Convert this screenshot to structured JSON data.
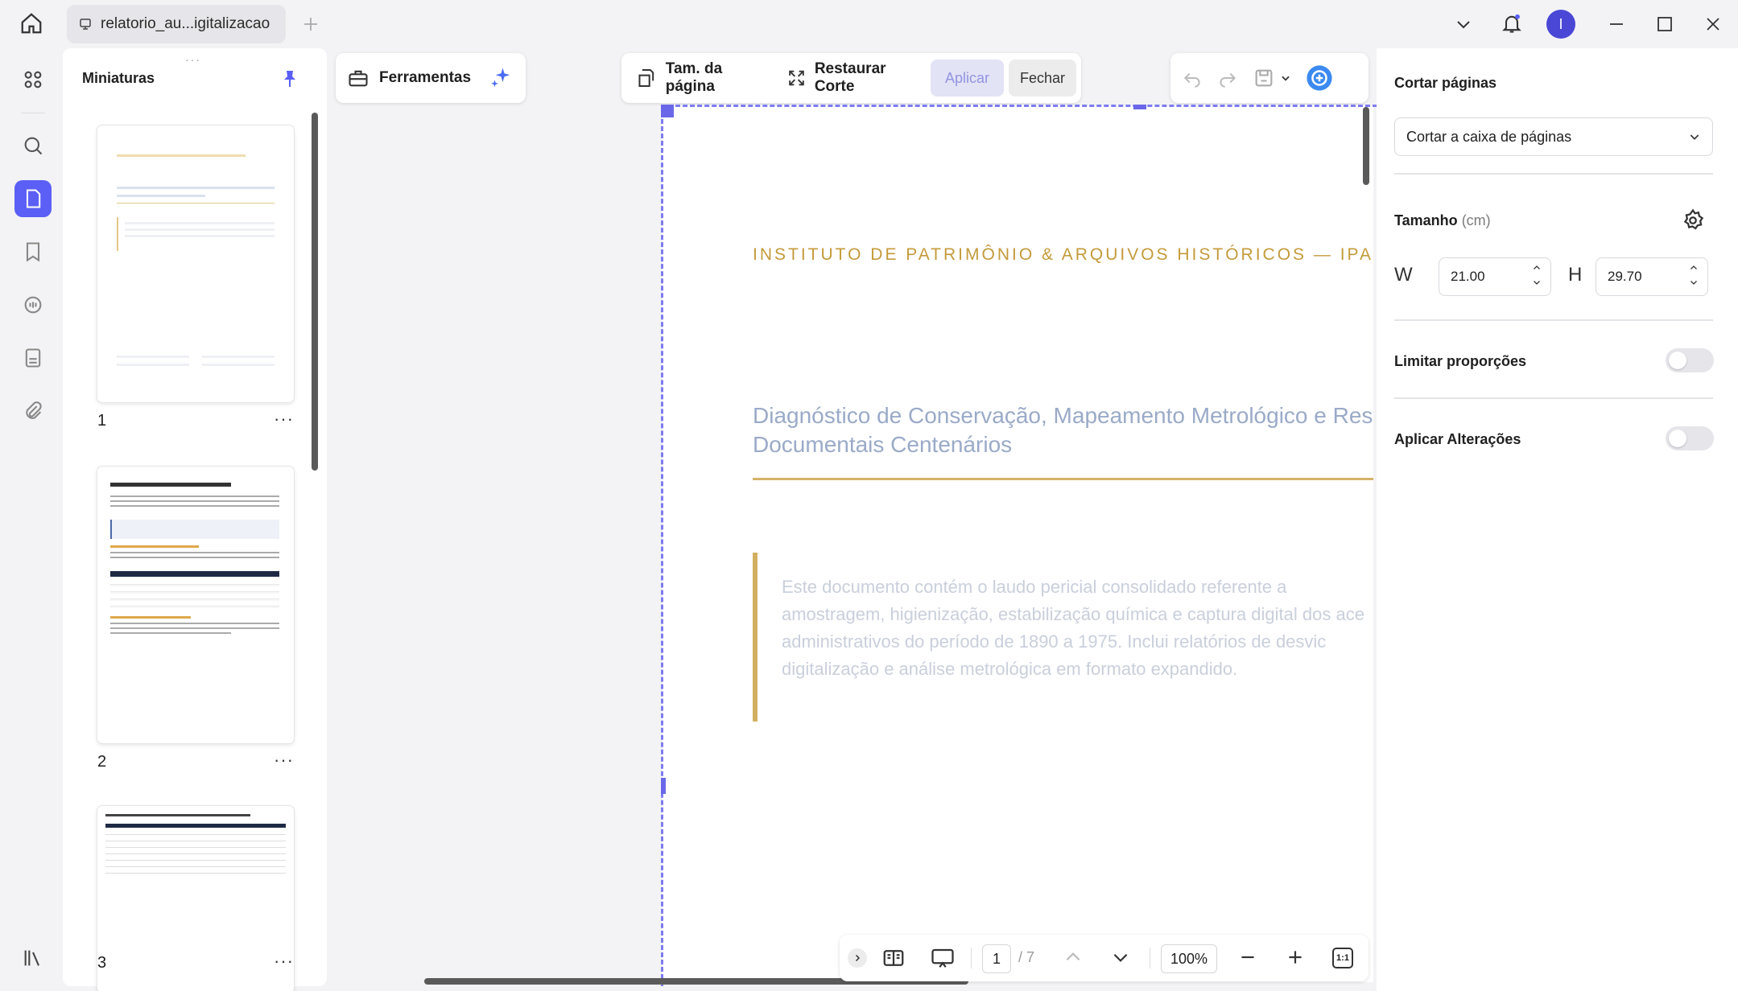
{
  "tab": {
    "title": "relatorio_au...igitalizacao"
  },
  "header": {
    "avatar_letter": "I"
  },
  "thumbnails": {
    "title": "Miniaturas",
    "pages": [
      {
        "number": "1",
        "more": "···"
      },
      {
        "number": "2",
        "more": "···"
      },
      {
        "number": "3",
        "more": "···"
      }
    ]
  },
  "toolbar": {
    "tools_label": "Ferramentas",
    "page_size_label": "Tam. da página",
    "restore_crop_label": "Restaurar Corte",
    "apply_label": "Aplicar",
    "close_label": "Fechar"
  },
  "document": {
    "org": "INSTITUTO DE PATRIMÔNIO & ARQUIVOS HISTÓRICOS — IPA",
    "title_line1": "Diagnóstico de Conservação, Mapeamento Metrológico e Restaur",
    "title_line2": "Documentais Centenários",
    "abstract": "Este documento contém o laudo pericial consolidado referente a\namostragem, higienização, estabilização química e captura digital dos ace\nadministrativos do período de 1890 a 1975. Inclui relatórios de desvic\ndigitalização e análise metrológica em formato expandido."
  },
  "navigation": {
    "current_page": "1",
    "total_pages": "/ 7",
    "zoom": "100%",
    "fit_label": "1:1"
  },
  "crop_panel": {
    "title": "Cortar páginas",
    "mode": "Cortar a caixa de páginas",
    "size_label": "Tamanho",
    "size_unit": "(cm)",
    "width_letter": "W",
    "width_value": "21.00",
    "height_letter": "H",
    "height_value": "29.70",
    "lock_ratio_label": "Limitar proporções",
    "lock_ratio_on": false,
    "apply_changes_label": "Aplicar Alterações",
    "apply_changes_on": false
  },
  "colors": {
    "accent": "#5b5ff5",
    "gold": "#c49a3a"
  }
}
